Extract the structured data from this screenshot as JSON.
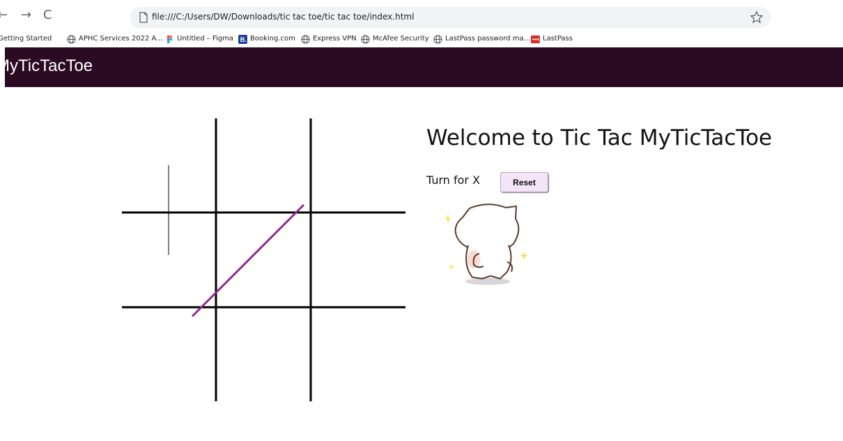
{
  "browser": {
    "back_glyph": "←",
    "forward_glyph": "→",
    "reload_glyph": "C",
    "url": "file:///C:/Users/DW/Downloads/tic tac toe/tic tac toe/index.html",
    "bookmarks": [
      {
        "label": "Getting Started",
        "icon": "page-icon"
      },
      {
        "label": "APHC Services 2022 A...",
        "icon": "globe-icon"
      },
      {
        "label": "Untitled – Figma",
        "icon": "figma-icon"
      },
      {
        "label": "Booking.com",
        "icon": "booking-icon"
      },
      {
        "label": "Express VPN",
        "icon": "globe-icon"
      },
      {
        "label": "McAfee Security",
        "icon": "globe-icon"
      },
      {
        "label": "LastPass password ma...",
        "icon": "globe-icon"
      },
      {
        "label": "LastPass",
        "icon": "lastpass-icon"
      }
    ]
  },
  "app": {
    "title": "MyTicTacToe",
    "header_color": "#2b0a23"
  },
  "info": {
    "welcome": "Welcome to Tic Tac MyTicTacToe",
    "turn": "Turn for X",
    "reset_label": "Reset"
  },
  "board": {
    "line_color": "#000000",
    "win_line_color": "#8e2a8e",
    "cells": [
      "",
      "",
      "",
      "",
      "",
      "",
      "",
      "",
      ""
    ]
  }
}
